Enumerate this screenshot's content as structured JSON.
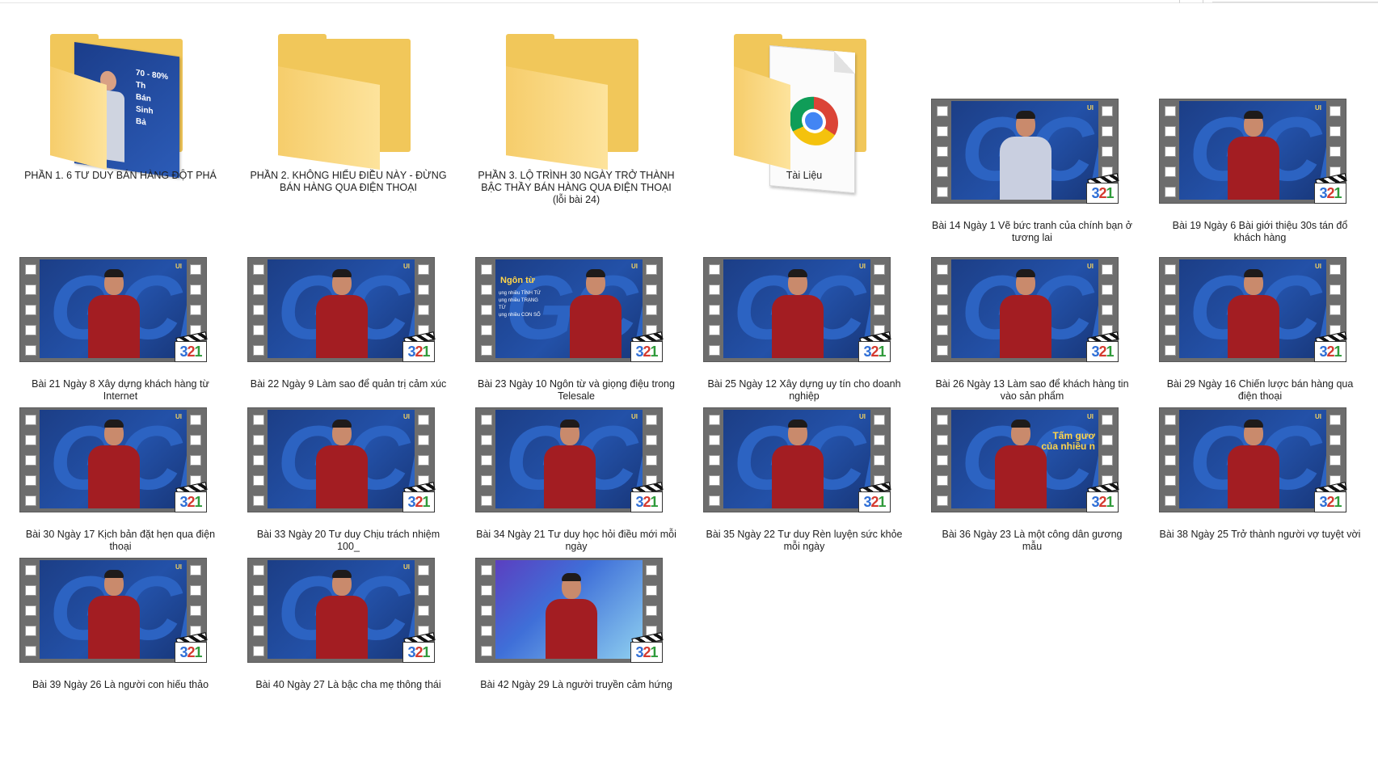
{
  "window": {
    "title": ""
  },
  "items": [
    {
      "kind": "folder",
      "variant": "photo",
      "label": "PHẦN 1. 6 TƯ DUY BÁN HÀNG ĐỘT PHÁ",
      "photo_text": [
        "70 - 80%",
        "Th",
        "Bán",
        "Sinh",
        "Bả"
      ]
    },
    {
      "kind": "folder",
      "variant": "plain",
      "label": "PHẦN 2. KHÔNG HIỂU ĐIỀU NÀY - ĐỪNG BÁN HÀNG QUA ĐIỆN THOẠI"
    },
    {
      "kind": "folder",
      "variant": "plain",
      "label": "PHẦN 3. LỘ TRÌNH 30 NGÀY TRỞ THÀNH BẬC THẦY BÁN HÀNG QUA ĐIỆN THOẠI (lỗi bài 24)"
    },
    {
      "kind": "folder",
      "variant": "chrome",
      "label": "Tài Liệu"
    },
    {
      "kind": "video",
      "style": "white",
      "label": "Bài 14 Ngày 1 Vẽ bức tranh của chính bạn ở tương lai"
    },
    {
      "kind": "video",
      "style": "red",
      "label": "Bài 19 Ngày 6 Bài giới thiệu 30s tán đổ khách hàng"
    },
    {
      "kind": "video",
      "style": "red",
      "label": "Bài 21 Ngày 8 Xây dựng khách hàng từ Internet"
    },
    {
      "kind": "video",
      "style": "red",
      "label": "Bài 22 Ngày 9 Làm sao để quản trị cảm xúc"
    },
    {
      "kind": "video",
      "style": "text",
      "label": "Bài 23 Ngày 10 Ngôn từ và giọng điệu trong Telesale",
      "overlay_title": "Ngôn từ",
      "overlay_lines": [
        "ụng nhiều TÍNH TỪ",
        "ụng nhiều TRẠNG TỪ",
        "ụng nhiều CON SỐ"
      ]
    },
    {
      "kind": "video",
      "style": "red",
      "label": "Bài 25 Ngày 12 Xây dựng uy tín cho doanh nghiệp"
    },
    {
      "kind": "video",
      "style": "red",
      "label": "Bài 26 Ngày 13 Làm sao để khách hàng tin vào sản phẩm"
    },
    {
      "kind": "video",
      "style": "red",
      "label": "Bài 29 Ngày 16 Chiến lược bán hàng qua điện thoại"
    },
    {
      "kind": "video",
      "style": "red",
      "label": "Bài 30 Ngày 17 Kịch bản đặt hẹn qua điện thoại"
    },
    {
      "kind": "video",
      "style": "red",
      "label": "Bài 33 Ngày 20 Tư duy Chịu trách nhiệm 100_"
    },
    {
      "kind": "video",
      "style": "red",
      "label": "Bài 34 Ngày 21 Tư duy học hỏi điều mới mỗi ngày"
    },
    {
      "kind": "video",
      "style": "red",
      "label": "Bài 35 Ngày 22 Tư duy Rèn luyện sức khỏe mỗi ngày"
    },
    {
      "kind": "video",
      "style": "right-text",
      "label": "Bài 36 Ngày 23 Là một công dân gương mẫu",
      "overlay_right": [
        "Tấm gươ",
        "của nhiều n"
      ]
    },
    {
      "kind": "video",
      "style": "red",
      "label": "Bài 38 Ngày 25 Trở thành người vợ tuyệt vời"
    },
    {
      "kind": "video",
      "style": "red",
      "label": "Bài 39 Ngày 26 Là người con hiếu thảo"
    },
    {
      "kind": "video",
      "style": "red",
      "label": "Bài 40 Ngày 27 Là bậc cha mẹ thông thái"
    },
    {
      "kind": "video",
      "style": "light",
      "label": "Bài 42 Ngày 29 Là người truyền cảm hứng"
    }
  ],
  "badge_digits": [
    "3",
    "2",
    "1"
  ],
  "frame_brand": "UI",
  "frame_letters": "GCL",
  "colors": {
    "folder": "#f1c75a",
    "folder_front": "#fddc88",
    "frame_blue": "#2351a8",
    "shirt_red": "#a31d22",
    "label_text": "#1f1f1f"
  }
}
